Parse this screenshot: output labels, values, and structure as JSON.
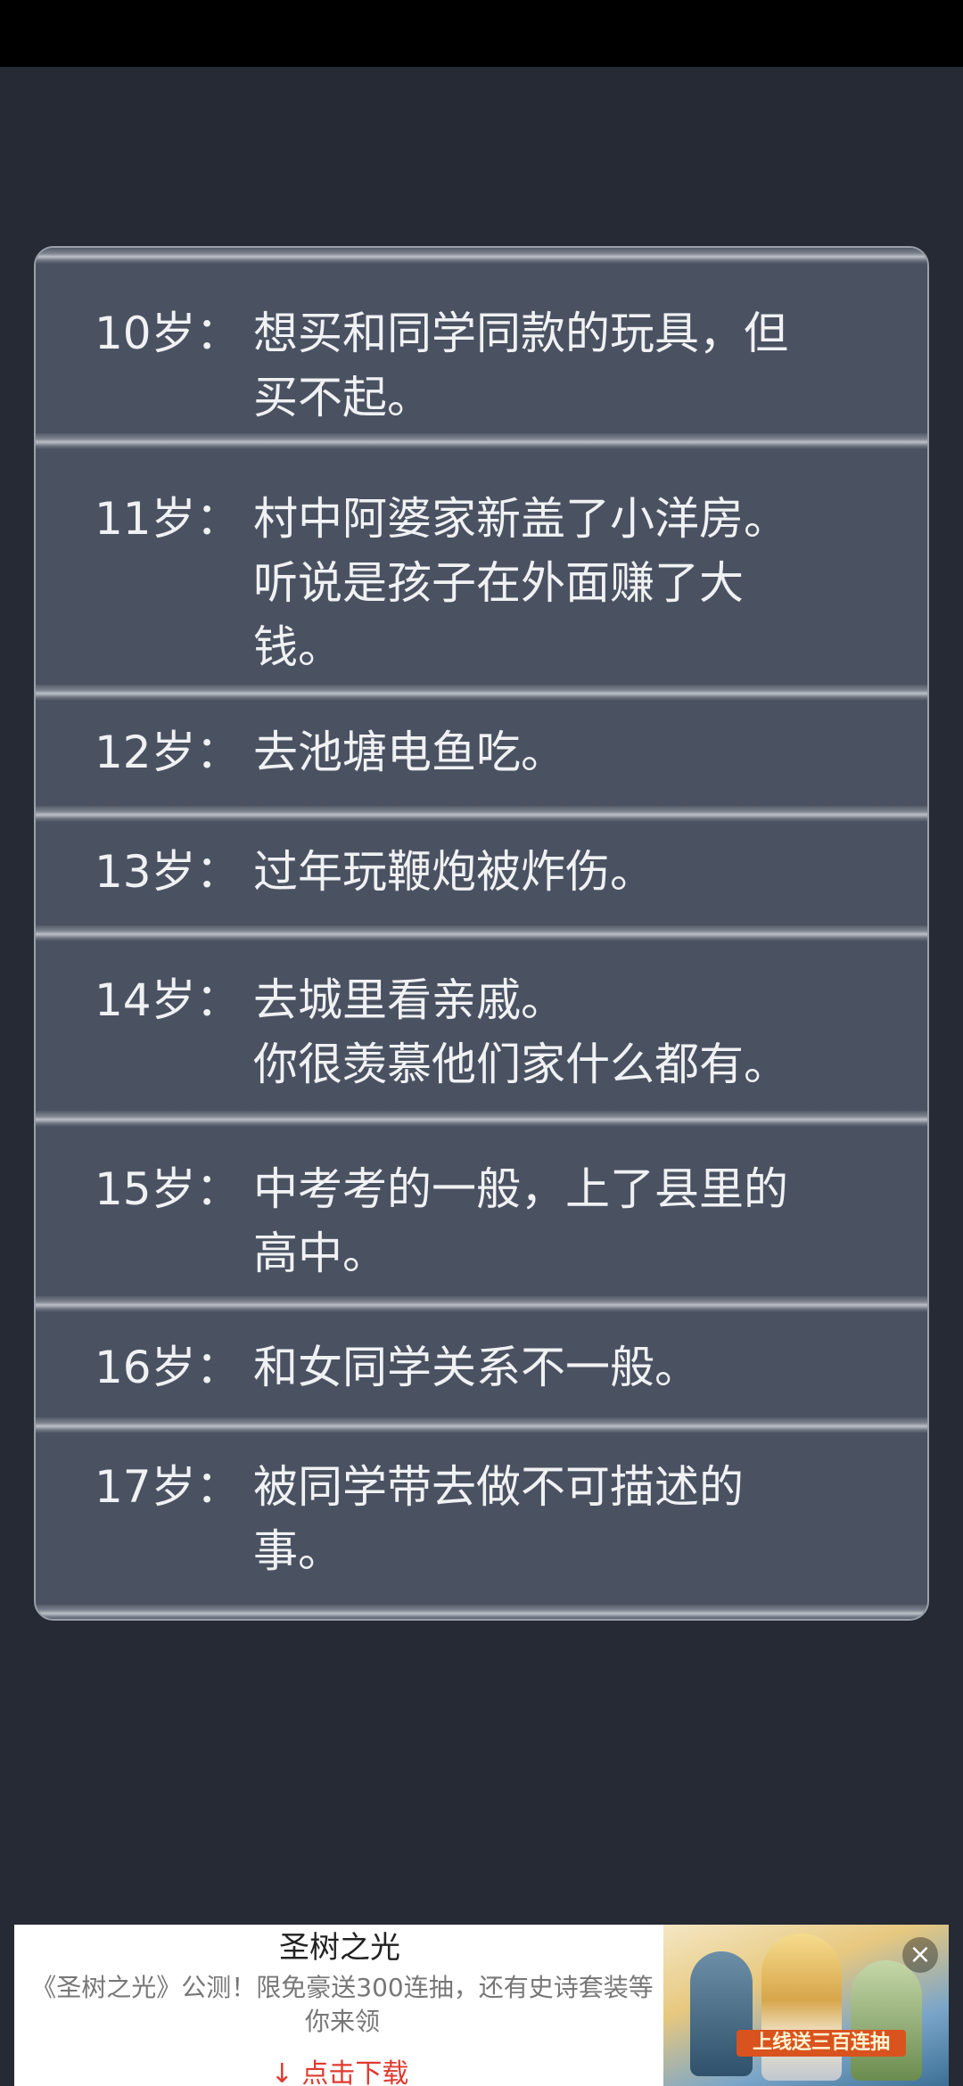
{
  "events": [
    {
      "age": "10岁：",
      "text": "想买和同学同款的玩具，但\n买不起。"
    },
    {
      "age": "11岁：",
      "text": "村中阿婆家新盖了小洋房。\n听说是孩子在外面赚了大\n钱。"
    },
    {
      "age": "12岁：",
      "text": "去池塘电鱼吃。"
    },
    {
      "age": "13岁：",
      "text": "过年玩鞭炮被炸伤。"
    },
    {
      "age": "14岁：",
      "text": "去城里看亲戚。\n你很羡慕他们家什么都有。"
    },
    {
      "age": "15岁：",
      "text": "中考考的一般，上了县里的\n高中。"
    },
    {
      "age": "16岁：",
      "text": "和女同学关系不一般。"
    },
    {
      "age": "17岁：",
      "text": "被同学带去做不可描述的\n事。"
    }
  ],
  "ad": {
    "title": "圣树之光",
    "description": "《圣树之光》公测！限免豪送300连抽，还有史诗套装等你来领",
    "cta_icon": "download-arrow-icon",
    "cta": "↓ 点击下载",
    "image_banner": "上线送三百连抽",
    "close_icon": "close-icon"
  },
  "colors": {
    "background": "#252a34",
    "panel": "#4a5262",
    "text": "#f0f1f3",
    "cta": "#e03a2f"
  }
}
